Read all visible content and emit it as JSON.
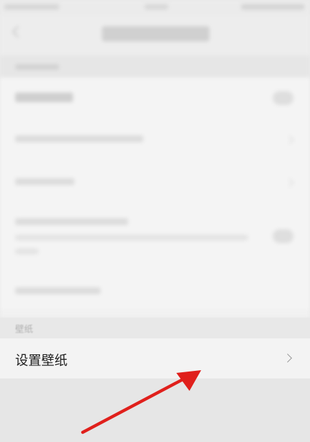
{
  "wallpaper_section": {
    "header": "壁纸",
    "row_label": "设置壁纸"
  },
  "icons": {
    "row_chevron": "chevron-right-icon",
    "annotation": "red-arrow-icon"
  },
  "colors": {
    "annotation_arrow": "#e0201c",
    "row_background": "#f3f3f3",
    "page_background": "#e9e9e9"
  }
}
